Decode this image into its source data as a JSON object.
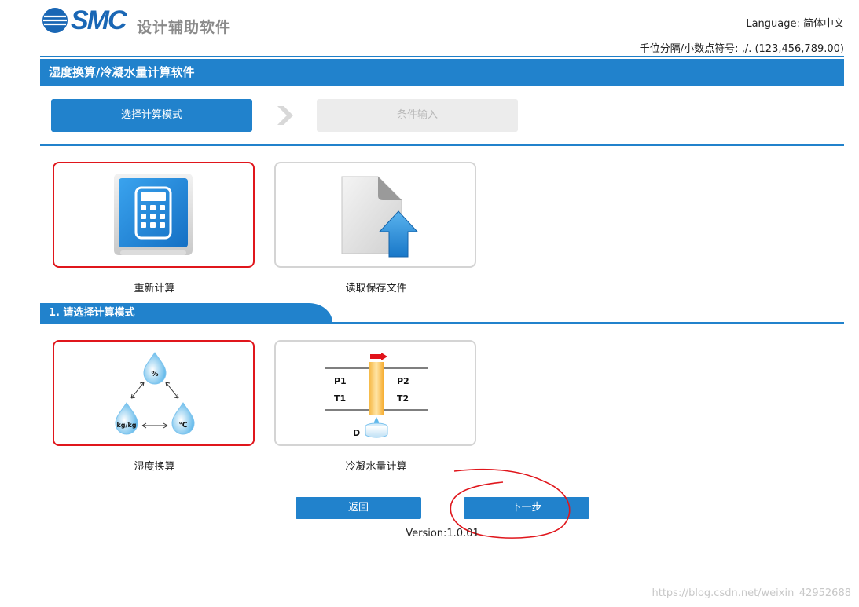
{
  "header": {
    "brand": "SMC",
    "app_title": "设计辅助软件",
    "language": "Language: 简体中文",
    "separator_setting": "千位分隔/小数点符号: ,/. (123,456,789.00)"
  },
  "title_bar": "湿度换算/冷凝水量计算软件",
  "steps": [
    {
      "label": "选择计算模式",
      "state": "active"
    },
    {
      "label": "条件输入",
      "state": "inactive"
    }
  ],
  "start_options": [
    {
      "label": "重新计算",
      "icon": "calculator-icon",
      "selected": true
    },
    {
      "label": "读取保存文件",
      "icon": "file-upload-icon",
      "selected": false
    }
  ],
  "mode_section": {
    "title": "1. 请选择计算模式"
  },
  "mode_options": [
    {
      "label": "湿度换算",
      "icon": "humidity-conversion-icon",
      "selected": true,
      "drops": [
        "%",
        "kg/kg",
        "℃"
      ]
    },
    {
      "label": "冷凝水量计算",
      "icon": "condensation-icon",
      "selected": false,
      "pipe_labels": [
        "P1",
        "T1",
        "P2",
        "T2",
        "D"
      ]
    }
  ],
  "buttons": {
    "back": "返回",
    "next": "下一步"
  },
  "version": "Version:1.0.01",
  "watermark": "https://blog.csdn.net/weixin_42952688",
  "colors": {
    "primary": "#2182cc",
    "brand": "#1a67b5",
    "selected_border": "#e0161c",
    "inactive_step": "#ececec"
  }
}
